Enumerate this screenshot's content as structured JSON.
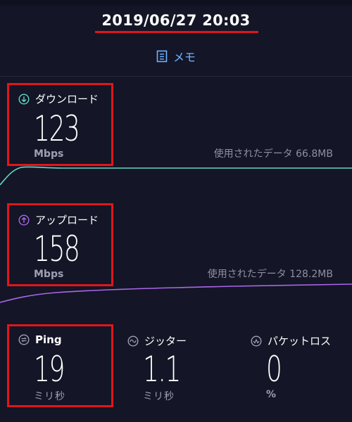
{
  "header": {
    "datetime": "2019/06/27 20:03",
    "memo_label": "メモ"
  },
  "download": {
    "label": "ダウンロード",
    "value": "123",
    "unit": "Mbps",
    "used_data": "使用されたデータ 66.8MB",
    "color": "#5fd8c8"
  },
  "upload": {
    "label": "アップロード",
    "value": "158",
    "unit": "Mbps",
    "used_data": "使用されたデータ 128.2MB",
    "color": "#a967e8"
  },
  "ping": {
    "label": "Ping",
    "value": "19",
    "unit": "ミリ秒"
  },
  "jitter": {
    "label": "ジッター",
    "value": "1.1",
    "unit": "ミリ秒"
  },
  "packet_loss": {
    "label": "パケットロス",
    "value": "0",
    "unit": "%"
  },
  "colors": {
    "accent": "#6fb3ff",
    "highlight": "#e0161c",
    "background": "#141526"
  }
}
